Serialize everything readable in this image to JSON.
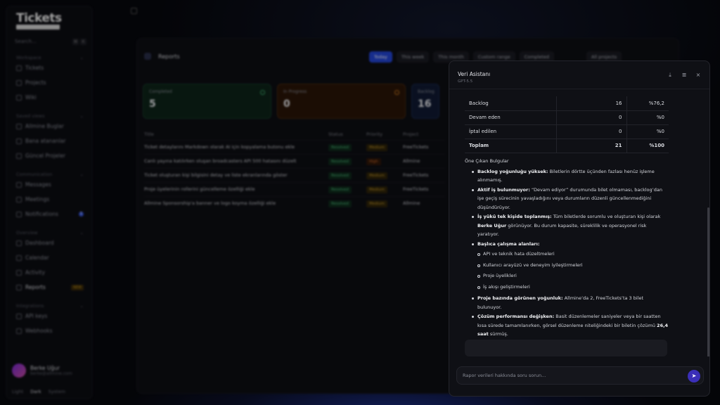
{
  "sidebar": {
    "logo": "Tickets",
    "search_placeholder": "Search...",
    "kbd": [
      "⌘",
      "K"
    ],
    "sections": [
      {
        "title": "Workspace",
        "items": [
          "Tickets",
          "Projects",
          "Wiki"
        ]
      },
      {
        "title": "Saved views",
        "items": [
          "Allmine Buglar",
          "Bana atananlar",
          "Güncel Projeler"
        ]
      },
      {
        "title": "Communication",
        "items": [
          "Messages",
          "Meetings",
          "Notifications"
        ]
      },
      {
        "title": "Overview",
        "items": [
          "Dashboard",
          "Calendar",
          "Activity",
          "Reports"
        ]
      },
      {
        "title": "Integrations",
        "items": [
          "API keys",
          "Webhooks"
        ]
      }
    ],
    "notifications_badge": "1",
    "reports_badge": "NEW",
    "user": {
      "name": "Berke Uğur",
      "email": "berke@allmine.com"
    },
    "themes": [
      "Light",
      "Dark",
      "System"
    ]
  },
  "main": {
    "title": "Reports",
    "filters": [
      "Today",
      "This week",
      "This month",
      "Custom range",
      "Completed",
      "All projects"
    ],
    "cards": [
      {
        "label": "Completed",
        "value": "5"
      },
      {
        "label": "In Progress",
        "value": "0"
      },
      {
        "label": "Backlog",
        "value": "16"
      }
    ],
    "columns": [
      "Title",
      "Status",
      "Priority",
      "Project"
    ],
    "rows": [
      {
        "title": "Ticket detaylarını Markdown olarak AI için kopyalama butonu ekle",
        "status": "Resolved",
        "priority": "Medium",
        "project": "FreeTickets"
      },
      {
        "title": "Canlı yayına katılırken oluşan broadcasters API 500 hatasını düzelt",
        "status": "Resolved",
        "priority": "High",
        "project": "Allmine"
      },
      {
        "title": "Ticket oluşturan kişi bilgisini detay ve liste ekranlarında göster",
        "status": "Resolved",
        "priority": "Medium",
        "project": "FreeTickets"
      },
      {
        "title": "Proje üyelerinin rollerini güncelleme özelliği ekle",
        "status": "Resolved",
        "priority": "Medium",
        "project": "FreeTickets"
      },
      {
        "title": "Allmine Sponsorship'a banner ve logo koyma özelliği ekle",
        "status": "Resolved",
        "priority": "Medium",
        "project": "Allmine"
      }
    ]
  },
  "assistant": {
    "title": "Veri Asistanı",
    "model": "GPT-5.5",
    "stats": [
      {
        "label": "Backlog",
        "count": "16",
        "pct": "%76,2"
      },
      {
        "label": "Devam eden",
        "count": "0",
        "pct": "%0"
      },
      {
        "label": "İptal edilen",
        "count": "0",
        "pct": "%0"
      },
      {
        "label": "Toplam",
        "count": "21",
        "pct": "%100"
      }
    ],
    "findings_title": "Öne Çıkan Bulgular",
    "f1_b": "Backlog yoğunluğu yüksek:",
    "f1": " Biletlerin dörtte üçünden fazlası henüz işleme alınmamış.",
    "f2_b": "Aktif iş bulunmuyor:",
    "f2": " “Devam ediyor” durumunda bilet olmaması, backlog’dan işe geçiş sürecinin yavaşladığını veya durumların düzenli güncellenmediğini düşündürüyor.",
    "f3_b": "İş yükü tek kişide toplanmış:",
    "f3a": " Tüm biletlerde sorumlu ve oluşturan kişi olarak ",
    "f3_name": "Berke Uğur",
    "f3b": " görünüyor. Bu durum kapasite, süreklilik ve operasyonel risk yaratıyor.",
    "f4_b": "Başlıca çalışma alanları:",
    "f4_items": [
      "API ve teknik hata düzeltmeleri",
      "Kullanıcı arayüzü ve deneyim iyileştirmeleri",
      "Proje üyelikleri",
      "İş akışı geliştirmeleri"
    ],
    "f5_b": "Proje bazında görünen yoğunluk:",
    "f5": " Allmine’da 2, FreeTickets’ta 3 bilet bulunuyor.",
    "f6_b": "Çözüm performansı değişken:",
    "f6a": " Basit düzenlemeler saniyeler veya bir saatten kısa sürede tamamlanırken, görsel düzenleme niteliğindeki bir biletin çözümü ",
    "f6_time": "26,4 saat",
    "f6b": " sürmüş.",
    "input_placeholder": "Rapor verileri hakkında soru sorun..."
  }
}
